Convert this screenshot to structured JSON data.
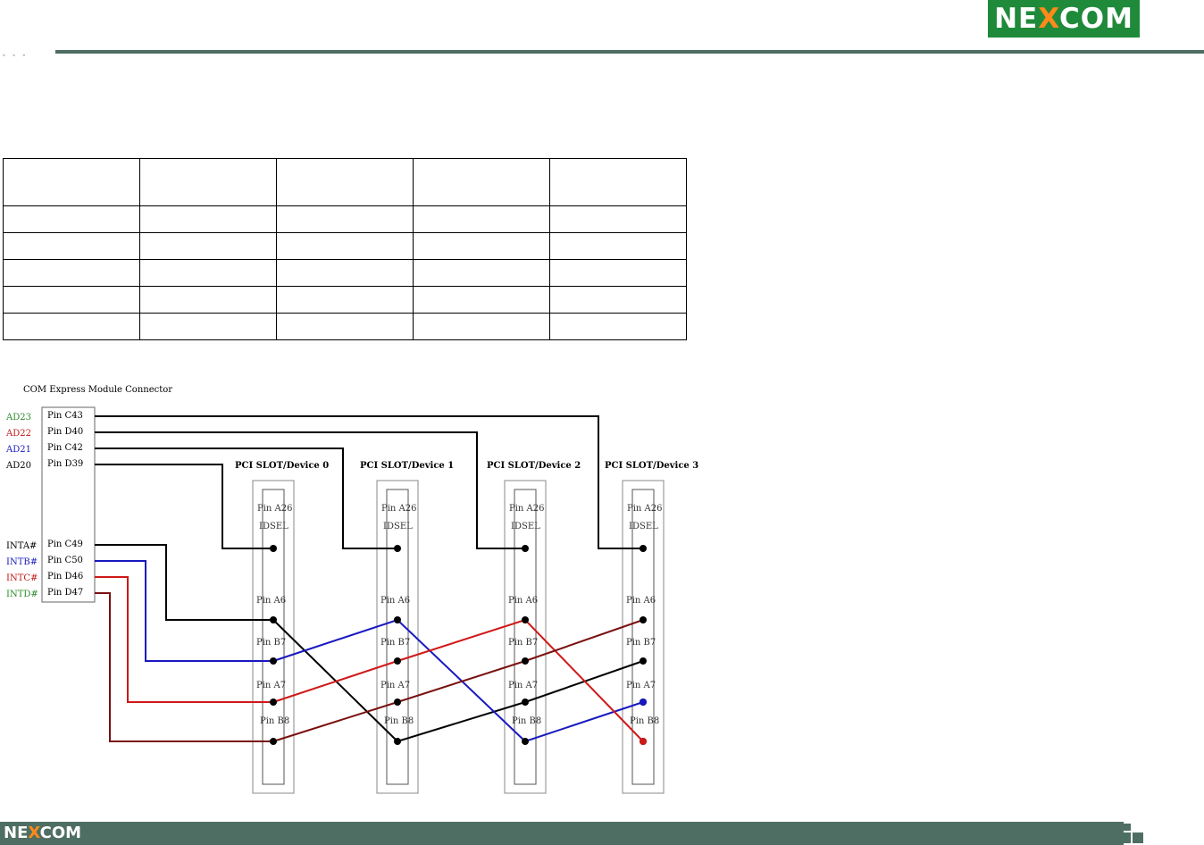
{
  "brand": {
    "logo_left": "NE",
    "logo_x": "X",
    "logo_right": "COM"
  },
  "diagram": {
    "title": "COM Express Module Connector",
    "signals": [
      {
        "name": "AD23",
        "pin": "Pin C43",
        "color": "#2a8a2a"
      },
      {
        "name": "AD22",
        "pin": "Pin D40",
        "color": "#c01818"
      },
      {
        "name": "AD21",
        "pin": "Pin C42",
        "color": "#1818c0"
      },
      {
        "name": "AD20",
        "pin": "Pin D39",
        "color": "#000000"
      },
      {
        "name": "INTA#",
        "pin": "Pin C49",
        "color": "#000000"
      },
      {
        "name": "INTB#",
        "pin": "Pin C50",
        "color": "#1818c0"
      },
      {
        "name": "INTC#",
        "pin": "Pin D46",
        "color": "#c01818"
      },
      {
        "name": "INTD#",
        "pin": "Pin D47",
        "color": "#2a8a2a"
      }
    ],
    "slots": [
      {
        "title": "PCI SLOT/Device 0",
        "idsel_pin": "Pin A26",
        "idsel": "IDSEL",
        "pins": [
          "Pin A6",
          "Pin B7",
          "Pin A7",
          "Pin B8"
        ]
      },
      {
        "title": "PCI SLOT/Device 1",
        "idsel_pin": "Pin A26",
        "idsel": "IDSEL",
        "pins": [
          "Pin A6",
          "Pin B7",
          "Pin A7",
          "Pin B8"
        ]
      },
      {
        "title": "PCI SLOT/Device 2",
        "idsel_pin": "Pin A26",
        "idsel": "IDSEL",
        "pins": [
          "Pin A6",
          "Pin B7",
          "Pin A7",
          "Pin B8"
        ]
      },
      {
        "title": "PCI SLOT/Device 3",
        "idsel_pin": "Pin A26",
        "idsel": "IDSEL",
        "pins": [
          "Pin A6",
          "Pin B7",
          "Pin A7",
          "Pin B8"
        ]
      }
    ],
    "wire_colors": {
      "black": "#000000",
      "blue": "#1818c0",
      "red": "#d01818",
      "darkred": "#7a1010"
    }
  }
}
